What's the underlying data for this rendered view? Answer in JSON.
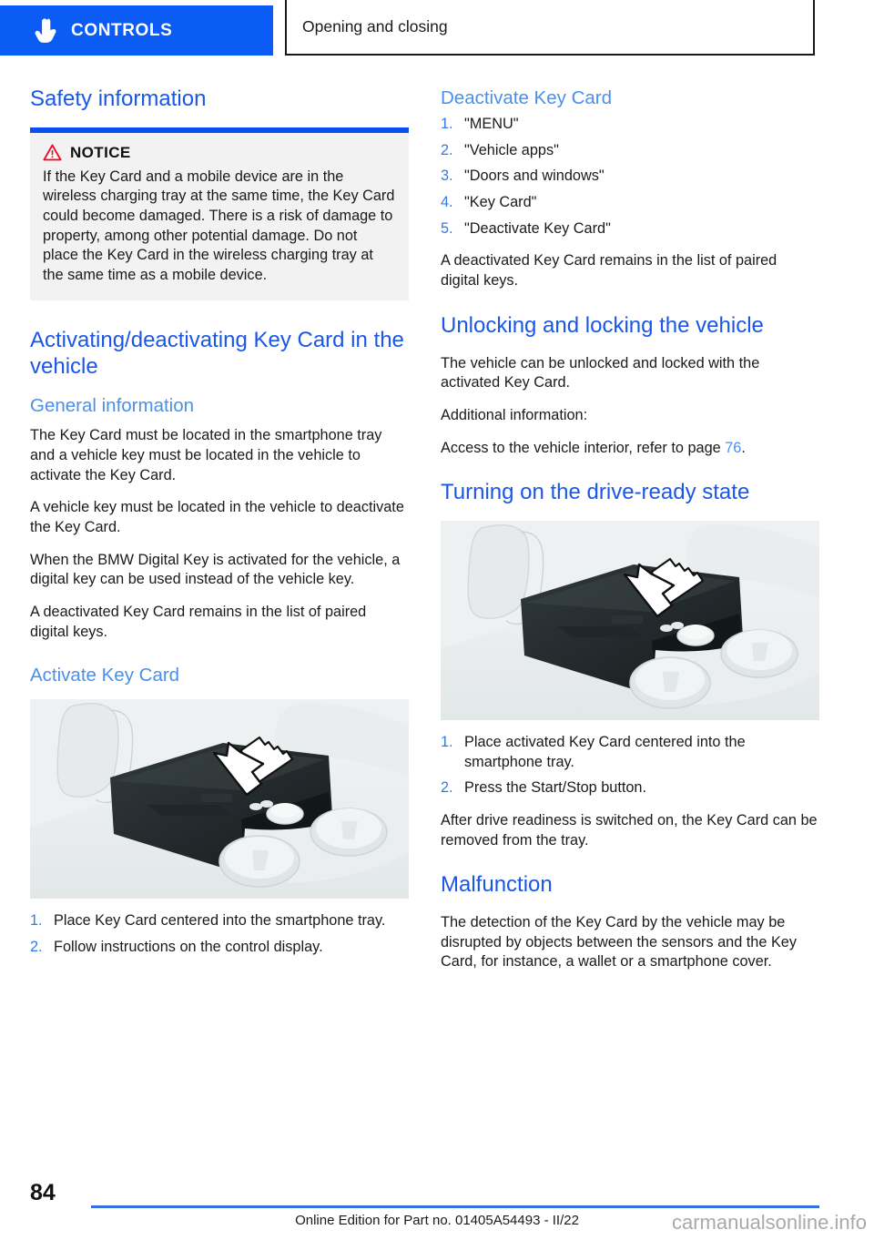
{
  "header": {
    "chapter": "CONTROLS",
    "chapter_icon": "pointing-hand-icon",
    "section": "Opening and closing",
    "accent_color": "#0a5cf5"
  },
  "left_column": {
    "heading": "Safety information",
    "notice": {
      "icon": "warning-triangle-icon",
      "title": "NOTICE",
      "text": "If the Key Card and a mobile device are in the wireless charging tray at the same time, the Key Card could become damaged. There is a risk of damage to property, among other potential damage. Do not place the Key Card in the wireless charging tray at the same time as a mobile device."
    },
    "heading2": "Activating/deactivating Key Card in the vehicle",
    "subheading_general": "General information",
    "general_paragraphs": [
      "The Key Card must be located in the smartphone tray and a vehicle key must be located in the vehicle to activate the Key Card.",
      "A vehicle key must be located in the vehicle to deactivate the Key Card.",
      "When the BMW Digital Key is activated for the vehicle, a digital key can be used instead of the vehicle key.",
      "A deactivated Key Card remains in the list of paired digital keys."
    ],
    "subheading_activate": "Activate Key Card",
    "figure_caption": "center-console-smartphone-tray-with-key-card-arrow",
    "activate_steps": [
      {
        "num": "1.",
        "text": "Place Key Card centered into the smartphone tray."
      },
      {
        "num": "2.",
        "text": "Follow instructions on the control display."
      }
    ]
  },
  "right_column": {
    "subheading_deactivate": "Deactivate Key Card",
    "deactivate_steps": [
      {
        "num": "1.",
        "text": "\"MENU\""
      },
      {
        "num": "2.",
        "text": "\"Vehicle apps\""
      },
      {
        "num": "3.",
        "text": "\"Doors and windows\""
      },
      {
        "num": "4.",
        "text": "\"Key Card\""
      },
      {
        "num": "5.",
        "text": "\"Deactivate Key Card\""
      }
    ],
    "deactivate_note": "A deactivated Key Card remains in the list of paired digital keys.",
    "heading_unlocking": "Unlocking and locking the vehicle",
    "unlocking_paragraphs": [
      "The vehicle can be unlocked and locked with the activated Key Card.",
      "Additional information:"
    ],
    "reference_prefix": "Access to the vehicle interior, refer to page ",
    "reference_page": "76",
    "reference_suffix": ".",
    "heading_drive_ready": "Turning on the drive-ready state",
    "figure_caption": "center-console-smartphone-tray-with-key-card-arrow",
    "drive_ready_steps": [
      {
        "num": "1.",
        "text": "Place activated Key Card centered into the smartphone tray."
      },
      {
        "num": "2.",
        "text": "Press the Start/Stop button."
      }
    ],
    "drive_ready_note": "After drive readiness is switched on, the Key Card can be removed from the tray.",
    "heading_malfunction": "Malfunction",
    "malfunction_text": "The detection of the Key Card by the vehicle may be disrupted by objects between the sensors and the Key Card, for instance, a wallet or a smartphone cover."
  },
  "footer": {
    "page_number": "84",
    "edition": "Online Edition for Part no. 01405A54493 - II/22",
    "watermark": "carmanualsonline.info"
  }
}
